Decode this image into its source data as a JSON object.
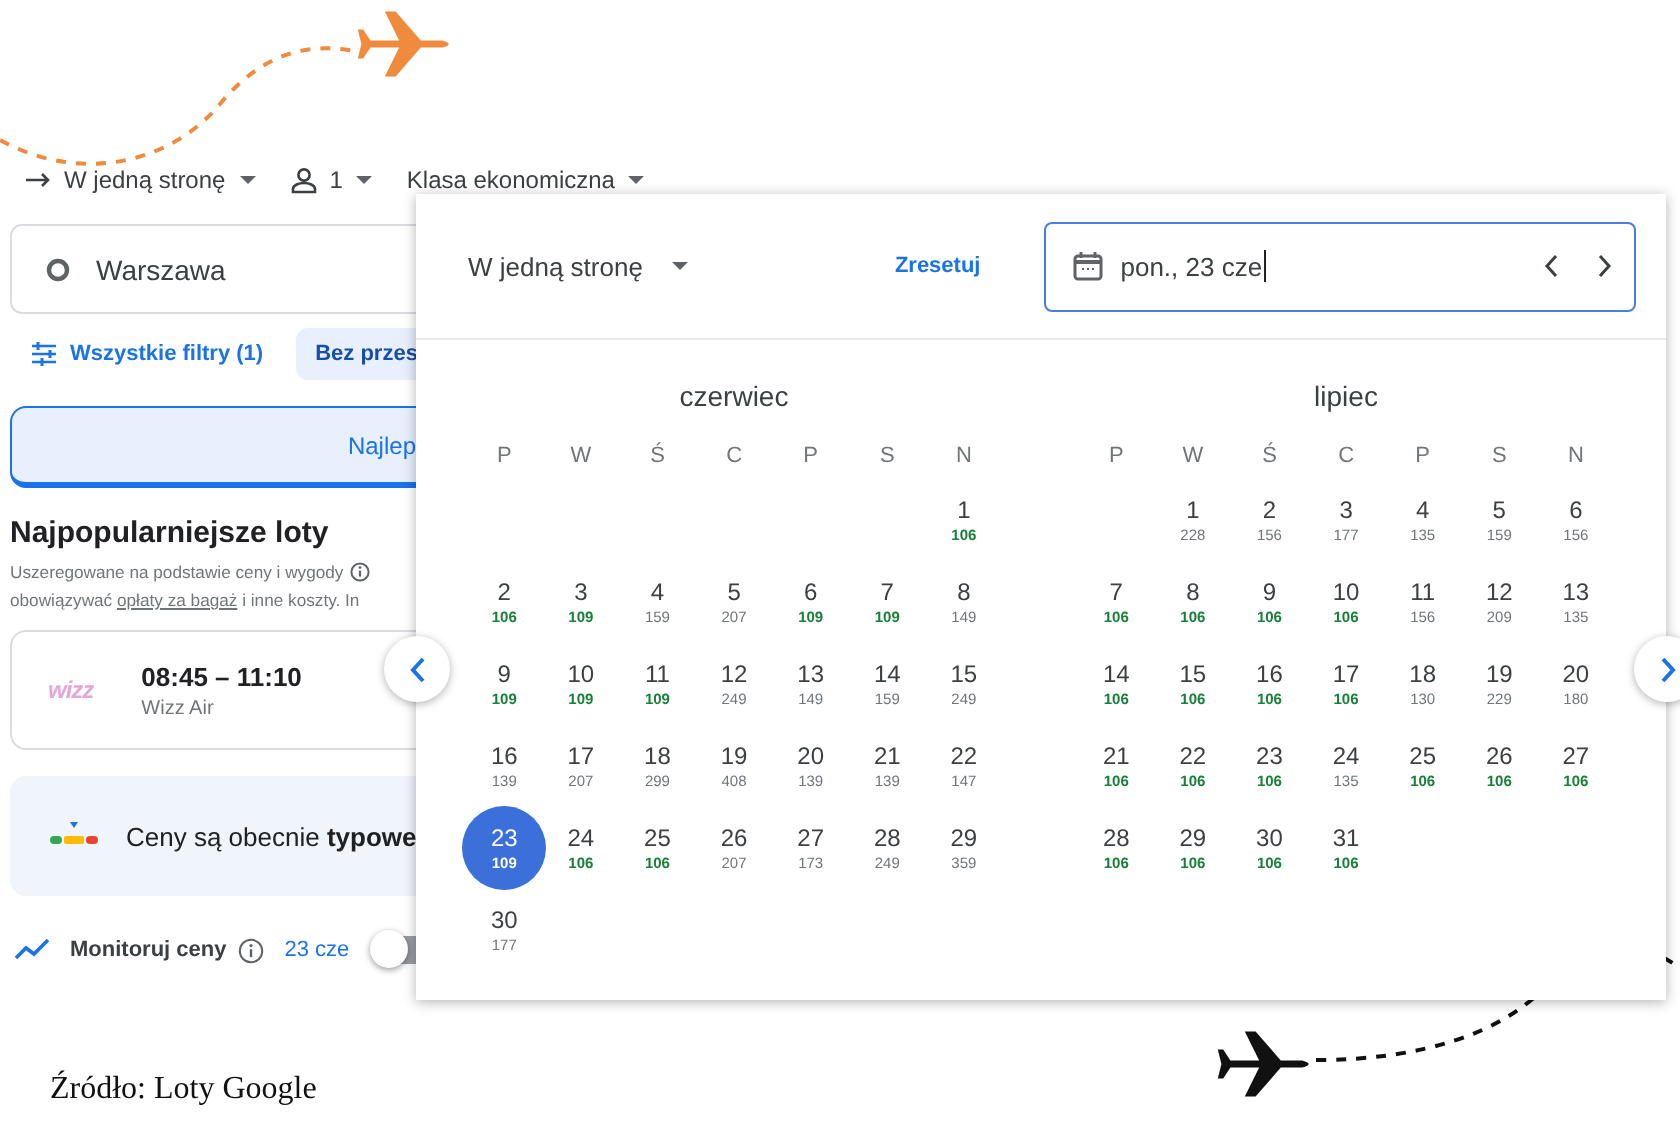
{
  "trip_bar": {
    "trip_type": "W jedną stronę",
    "passengers": "1",
    "cabin_class": "Klasa ekonomiczna"
  },
  "search": {
    "origin": "Warszawa"
  },
  "filters": {
    "all_filters": "Wszystkie filtry (1)",
    "chip": "Bez przes"
  },
  "sort_tab": {
    "label": "Najlep",
    "selected": true
  },
  "results": {
    "title": "Najpopularniejsze loty",
    "note": "Uszeregowane na podstawie ceny i wygody",
    "note_2": {
      "before": "obowiązywać ",
      "link": "opłaty za bagaż",
      "after": " i inne koszty. In"
    }
  },
  "flight": {
    "logo": "wizz",
    "times": "08:45 – 11:10",
    "airline": "Wizz Air"
  },
  "price_insight": "Ceny są obecnie **typowe**",
  "tracking": {
    "label": "Monitoruj ceny",
    "date": "23 cze",
    "on": false
  },
  "date_picker": {
    "trip_type": "W jedną stronę",
    "reset": "Zresetuj",
    "date_value": "pon., 23 cze",
    "months": [
      {
        "name": "czerwiec",
        "weekdays": [
          "P",
          "W",
          "Ś",
          "C",
          "P",
          "S",
          "N"
        ],
        "weeks": [
          [
            {
              "kind": "blank"
            },
            {
              "kind": "blank"
            },
            {
              "kind": "blank"
            },
            {
              "kind": "blank"
            },
            {
              "kind": "blank"
            },
            {
              "kind": "blank"
            },
            {
              "kind": "day",
              "day": "1",
              "price": "106",
              "cheap": true,
              "selected": false
            }
          ],
          [
            {
              "kind": "day",
              "day": "2",
              "price": "106",
              "cheap": true,
              "selected": false
            },
            {
              "kind": "day",
              "day": "3",
              "price": "109",
              "cheap": true,
              "selected": false
            },
            {
              "kind": "day",
              "day": "4",
              "price": "159",
              "cheap": false,
              "selected": false
            },
            {
              "kind": "day",
              "day": "5",
              "price": "207",
              "cheap": false,
              "selected": false
            },
            {
              "kind": "day",
              "day": "6",
              "price": "109",
              "cheap": true,
              "selected": false
            },
            {
              "kind": "day",
              "day": "7",
              "price": "109",
              "cheap": true,
              "selected": false
            },
            {
              "kind": "day",
              "day": "8",
              "price": "149",
              "cheap": false,
              "selected": false
            }
          ],
          [
            {
              "kind": "day",
              "day": "9",
              "price": "109",
              "cheap": true,
              "selected": false
            },
            {
              "kind": "day",
              "day": "10",
              "price": "109",
              "cheap": true,
              "selected": false
            },
            {
              "kind": "day",
              "day": "11",
              "price": "109",
              "cheap": true,
              "selected": false
            },
            {
              "kind": "day",
              "day": "12",
              "price": "249",
              "cheap": false,
              "selected": false
            },
            {
              "kind": "day",
              "day": "13",
              "price": "149",
              "cheap": false,
              "selected": false
            },
            {
              "kind": "day",
              "day": "14",
              "price": "159",
              "cheap": false,
              "selected": false
            },
            {
              "kind": "day",
              "day": "15",
              "price": "249",
              "cheap": false,
              "selected": false
            }
          ],
          [
            {
              "kind": "day",
              "day": "16",
              "price": "139",
              "cheap": false,
              "selected": false
            },
            {
              "kind": "day",
              "day": "17",
              "price": "207",
              "cheap": false,
              "selected": false
            },
            {
              "kind": "day",
              "day": "18",
              "price": "299",
              "cheap": false,
              "selected": false
            },
            {
              "kind": "day",
              "day": "19",
              "price": "408",
              "cheap": false,
              "selected": false
            },
            {
              "kind": "day",
              "day": "20",
              "price": "139",
              "cheap": false,
              "selected": false
            },
            {
              "kind": "day",
              "day": "21",
              "price": "139",
              "cheap": false,
              "selected": false
            },
            {
              "kind": "day",
              "day": "22",
              "price": "147",
              "cheap": false,
              "selected": false
            }
          ],
          [
            {
              "kind": "day",
              "day": "23",
              "price": "109",
              "cheap": true,
              "selected": true
            },
            {
              "kind": "day",
              "day": "24",
              "price": "106",
              "cheap": true,
              "selected": false
            },
            {
              "kind": "day",
              "day": "25",
              "price": "106",
              "cheap": true,
              "selected": false
            },
            {
              "kind": "day",
              "day": "26",
              "price": "207",
              "cheap": false,
              "selected": false
            },
            {
              "kind": "day",
              "day": "27",
              "price": "173",
              "cheap": false,
              "selected": false
            },
            {
              "kind": "day",
              "day": "28",
              "price": "249",
              "cheap": false,
              "selected": false
            },
            {
              "kind": "day",
              "day": "29",
              "price": "359",
              "cheap": false,
              "selected": false
            }
          ],
          [
            {
              "kind": "day",
              "day": "30",
              "price": "177",
              "cheap": false,
              "selected": false
            }
          ]
        ]
      },
      {
        "name": "lipiec",
        "weekdays": [
          "P",
          "W",
          "Ś",
          "C",
          "P",
          "S",
          "N"
        ],
        "weeks": [
          [
            {
              "kind": "blank"
            },
            {
              "kind": "day",
              "day": "1",
              "price": "228",
              "cheap": false,
              "selected": false
            },
            {
              "kind": "day",
              "day": "2",
              "price": "156",
              "cheap": false,
              "selected": false
            },
            {
              "kind": "day",
              "day": "3",
              "price": "177",
              "cheap": false,
              "selected": false
            },
            {
              "kind": "day",
              "day": "4",
              "price": "135",
              "cheap": false,
              "selected": false
            },
            {
              "kind": "day",
              "day": "5",
              "price": "159",
              "cheap": false,
              "selected": false
            },
            {
              "kind": "day",
              "day": "6",
              "price": "156",
              "cheap": false,
              "selected": false
            }
          ],
          [
            {
              "kind": "day",
              "day": "7",
              "price": "106",
              "cheap": true,
              "selected": false
            },
            {
              "kind": "day",
              "day": "8",
              "price": "106",
              "cheap": true,
              "selected": false
            },
            {
              "kind": "day",
              "day": "9",
              "price": "106",
              "cheap": true,
              "selected": false
            },
            {
              "kind": "day",
              "day": "10",
              "price": "106",
              "cheap": true,
              "selected": false
            },
            {
              "kind": "day",
              "day": "11",
              "price": "156",
              "cheap": false,
              "selected": false
            },
            {
              "kind": "day",
              "day": "12",
              "price": "209",
              "cheap": false,
              "selected": false
            },
            {
              "kind": "day",
              "day": "13",
              "price": "135",
              "cheap": false,
              "selected": false
            }
          ],
          [
            {
              "kind": "day",
              "day": "14",
              "price": "106",
              "cheap": true,
              "selected": false
            },
            {
              "kind": "day",
              "day": "15",
              "price": "106",
              "cheap": true,
              "selected": false
            },
            {
              "kind": "day",
              "day": "16",
              "price": "106",
              "cheap": true,
              "selected": false
            },
            {
              "kind": "day",
              "day": "17",
              "price": "106",
              "cheap": true,
              "selected": false
            },
            {
              "kind": "day",
              "day": "18",
              "price": "130",
              "cheap": false,
              "selected": false
            },
            {
              "kind": "day",
              "day": "19",
              "price": "229",
              "cheap": false,
              "selected": false
            },
            {
              "kind": "day",
              "day": "20",
              "price": "180",
              "cheap": false,
              "selected": false
            }
          ],
          [
            {
              "kind": "day",
              "day": "21",
              "price": "106",
              "cheap": true,
              "selected": false
            },
            {
              "kind": "day",
              "day": "22",
              "price": "106",
              "cheap": true,
              "selected": false
            },
            {
              "kind": "day",
              "day": "23",
              "price": "106",
              "cheap": true,
              "selected": false
            },
            {
              "kind": "day",
              "day": "24",
              "price": "135",
              "cheap": false,
              "selected": false
            },
            {
              "kind": "day",
              "day": "25",
              "price": "106",
              "cheap": true,
              "selected": false
            },
            {
              "kind": "day",
              "day": "26",
              "price": "106",
              "cheap": true,
              "selected": false
            },
            {
              "kind": "day",
              "day": "27",
              "price": "106",
              "cheap": true,
              "selected": false
            }
          ],
          [
            {
              "kind": "day",
              "day": "28",
              "price": "106",
              "cheap": true,
              "selected": false
            },
            {
              "kind": "day",
              "day": "29",
              "price": "106",
              "cheap": true,
              "selected": false
            },
            {
              "kind": "day",
              "day": "30",
              "price": "106",
              "cheap": true,
              "selected": false
            },
            {
              "kind": "day",
              "day": "31",
              "price": "106",
              "cheap": true,
              "selected": false
            }
          ]
        ]
      }
    ]
  },
  "caption": "Źródło: Loty Google"
}
